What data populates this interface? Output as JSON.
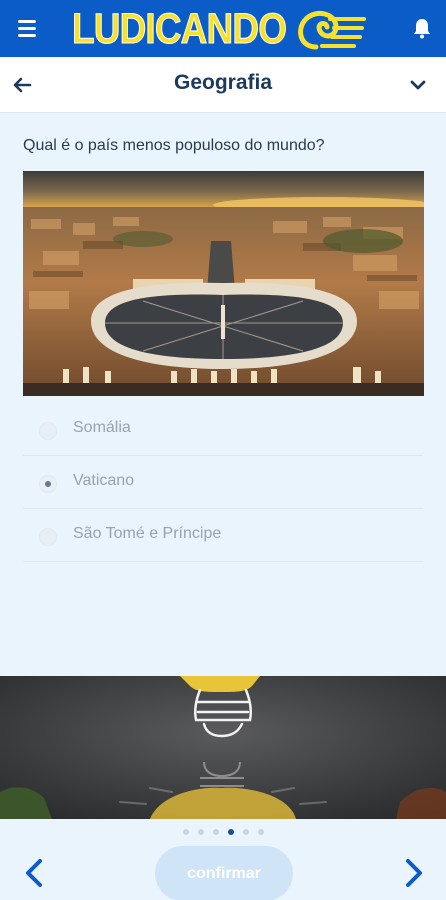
{
  "appbar": {
    "brand": "LUDICANDO",
    "menu_icon": "hamburger-menu-icon",
    "bell_icon": "bell-icon"
  },
  "category": {
    "title": "Geografia",
    "back_icon": "arrow-left-icon",
    "expand_icon": "chevron-down-icon"
  },
  "question": {
    "text": "Qual é o país menos populoso do mundo?",
    "image": "st-peters-square-aerial-photo",
    "options": [
      {
        "label": "Somália",
        "selected": false
      },
      {
        "label": "Vaticano",
        "selected": true
      },
      {
        "label": "São Tomé e Príncipe",
        "selected": false
      }
    ]
  },
  "banner": {
    "image": "lightbulb-illustration"
  },
  "pager": {
    "total": 6,
    "current": 4
  },
  "nav": {
    "confirm_label": "confirmar",
    "prev_icon": "chevron-left-icon",
    "next_icon": "chevron-right-icon"
  },
  "colors": {
    "brand_blue": "#0b5cc7",
    "logo_yellow": "#f6e22b",
    "title_navy": "#1c3a5e",
    "background": "#eaf4fd"
  }
}
